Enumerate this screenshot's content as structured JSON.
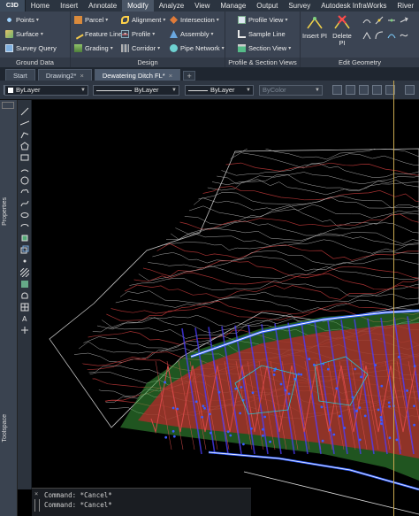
{
  "app": {
    "icon_label": "C3D"
  },
  "menu_tabs": [
    "Home",
    "Insert",
    "Annotate",
    "Modify",
    "Analyze",
    "View",
    "Manage",
    "Output",
    "Survey",
    "Autodesk InfraWorks",
    "River"
  ],
  "active_menu_tab": "Modify",
  "ribbon": {
    "ground_data": {
      "title": "Ground Data",
      "items": [
        "Points",
        "Surface",
        "Survey Query"
      ]
    },
    "design": {
      "title": "Design",
      "col1": [
        "Parcel",
        "Feature Line",
        "Grading"
      ],
      "col2": [
        "Alignment",
        "Profile",
        "Corridor"
      ],
      "col3": [
        "Intersection",
        "Assembly",
        "Pipe Network"
      ]
    },
    "profile_section": {
      "title": "Profile & Section Views",
      "items": [
        "Profile View",
        "Sample Line",
        "Section View"
      ]
    },
    "edit_geometry": {
      "title": "Edit Geometry",
      "insert_pi": "Insert PI",
      "delete_pi": "Delete PI"
    }
  },
  "doc_tabs": [
    {
      "label": "Start",
      "active": false
    },
    {
      "label": "Drawing2*",
      "active": false
    },
    {
      "label": "Dewatering Ditch FL*",
      "active": true
    }
  ],
  "properties_bar": {
    "layer": "ByLayer",
    "linetype": "ByLayer",
    "lineweight": "ByLayer",
    "color": "ByColor"
  },
  "side_panels": {
    "properties_label": "Properties",
    "toolspace_label": "Toolspace"
  },
  "command_history": [
    "Command: *Cancel*",
    "Command: *Cancel*"
  ],
  "colors": {
    "ribbon_bg": "#3b4453",
    "canvas_bg": "#000000",
    "contour_white": "#c8c8c8",
    "contour_red": "#c23a3a",
    "alignment_blue": "#2f5dff",
    "grading_red": "#b4282a",
    "grading_green": "#3a9a3a"
  }
}
